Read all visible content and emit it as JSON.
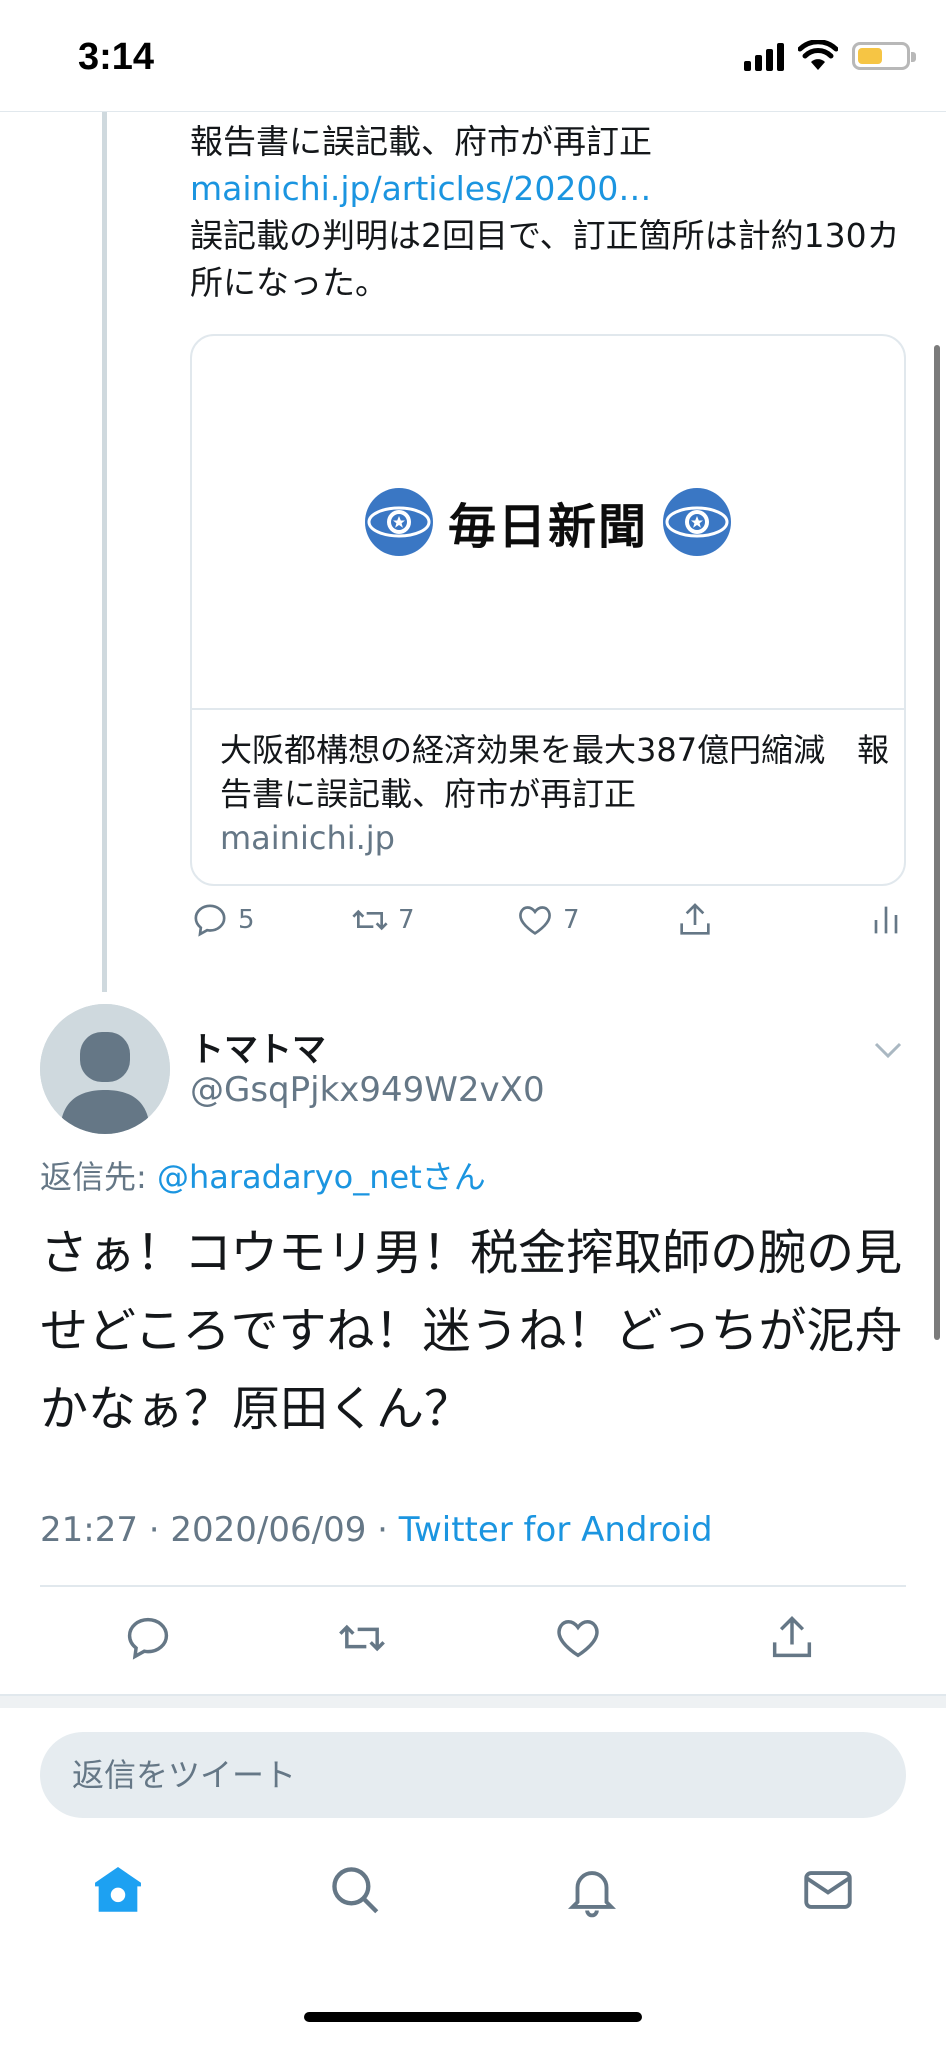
{
  "status_bar": {
    "time": "3:14",
    "battery_color": "#f6c544"
  },
  "prev_tweet": {
    "text_line1": "報告書に誤記載、府市が再訂正",
    "link": "mainichi.jp/articles/20200…",
    "text_line2": "誤記載の判明は2回目で、訂正箇所は計約130カ所になった。",
    "card": {
      "brand": "毎日新聞",
      "title": "大阪都構想の経済効果を最大387億円縮減　報告書に誤記載、府市が再訂正",
      "domain": "mainichi.jp"
    },
    "actions": {
      "replies": "5",
      "retweets": "7",
      "likes": "7"
    }
  },
  "tweet": {
    "display_name": "トマトマ",
    "handle": "@GsqPjkx949W2vX0",
    "reply_prefix": "返信先: ",
    "reply_to": "@haradaryo_netさん",
    "text": "さぁ！コウモリ男！税金搾取師の腕の見せどころですね！迷うね！どっちが泥舟かなぁ？原田くん？",
    "timestamp": "21:27 · 2020/06/09 · ",
    "source": "Twitter for Android"
  },
  "composer": {
    "placeholder": "返信をツイート"
  },
  "tabs": [
    "home-icon",
    "search-icon",
    "bell-icon",
    "mail-icon"
  ],
  "colors": {
    "link": "#1b95e0",
    "muted": "#657786",
    "accent": "#1da1f2"
  }
}
